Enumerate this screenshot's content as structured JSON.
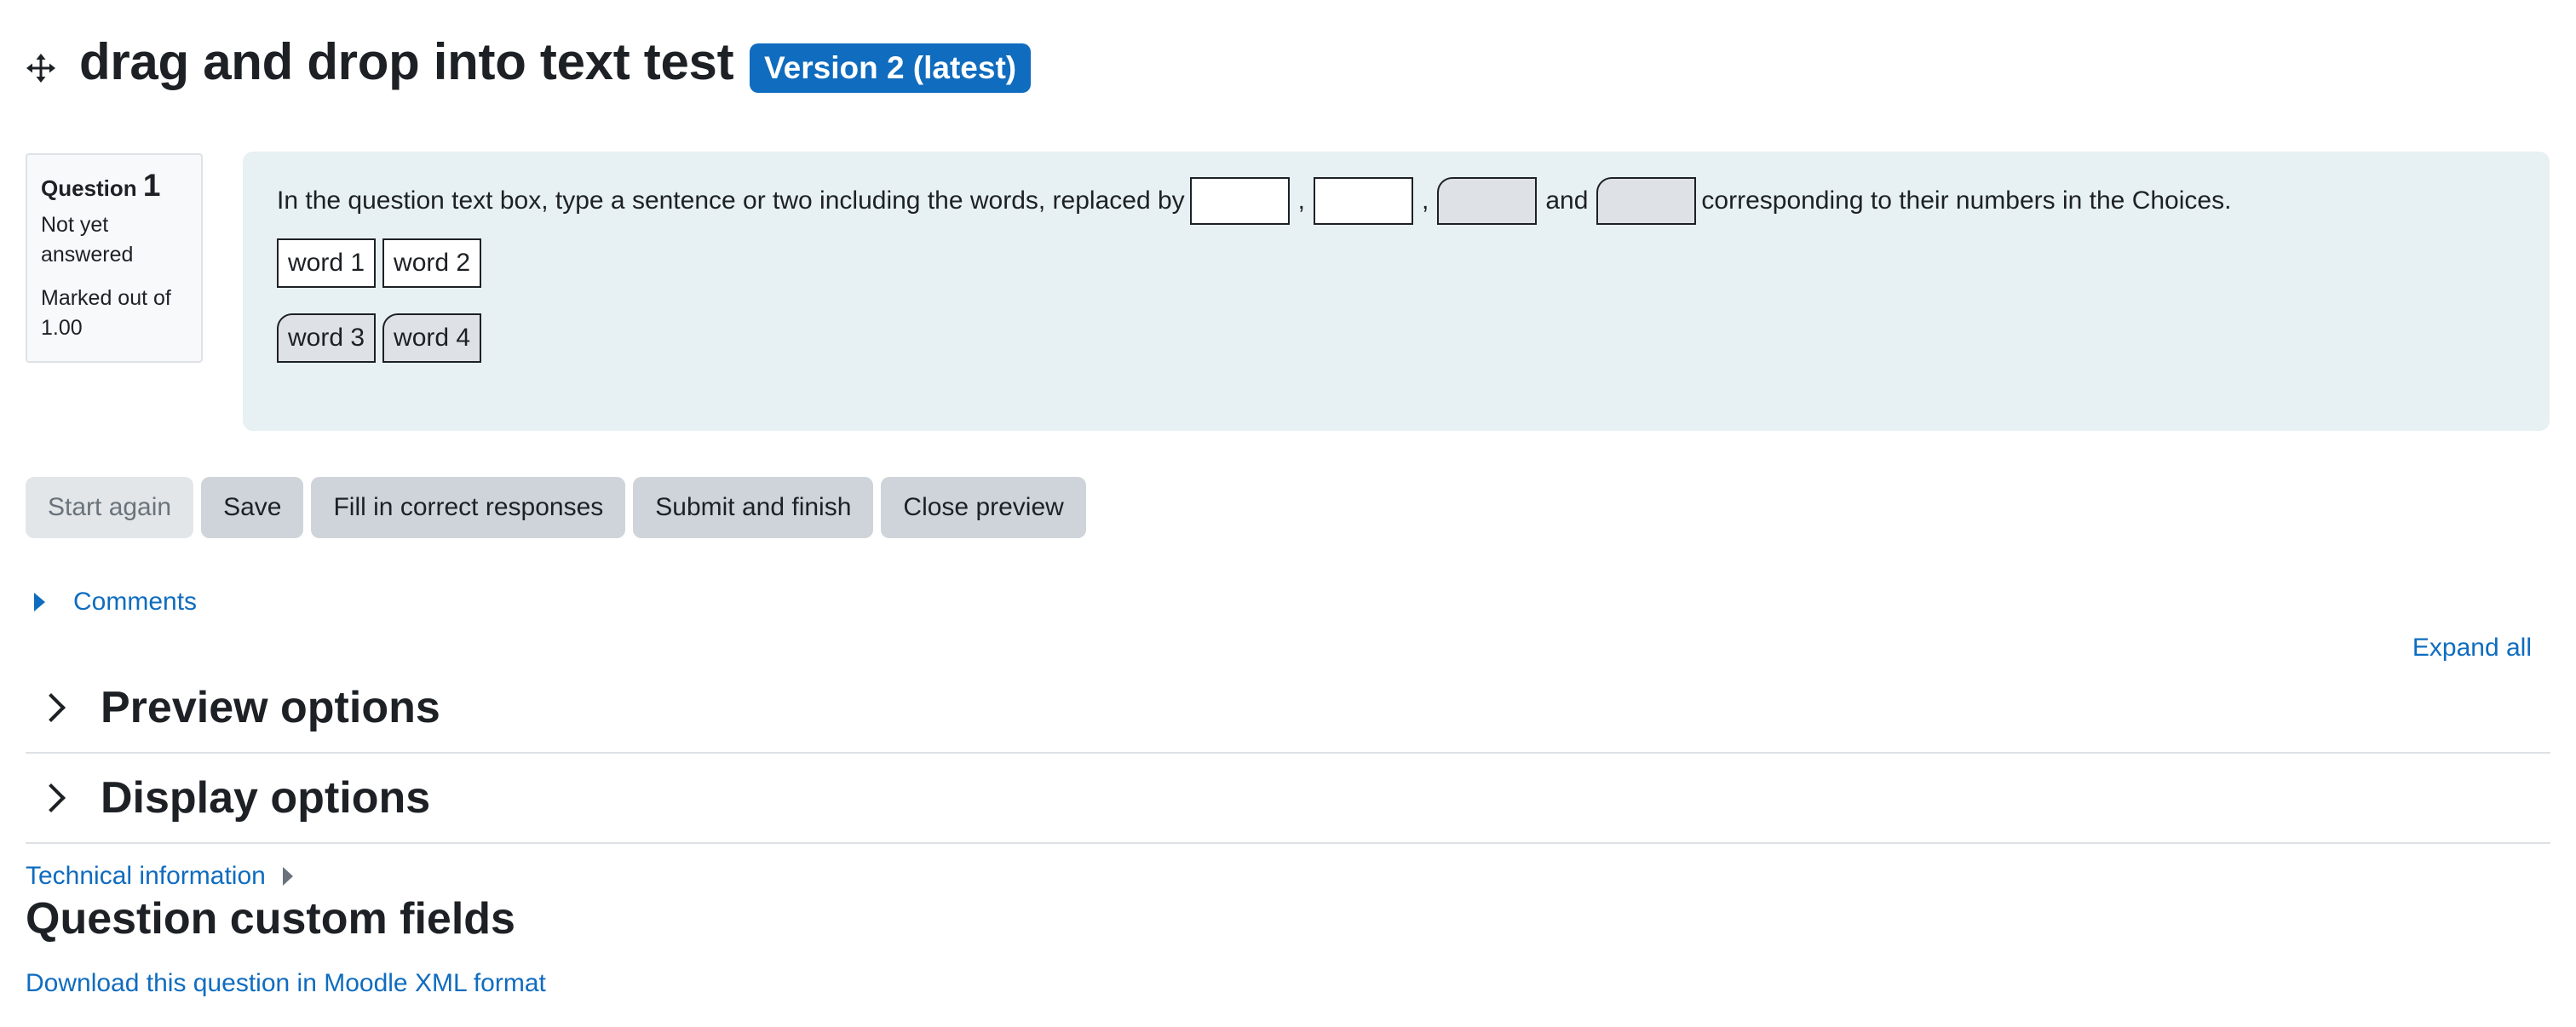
{
  "header": {
    "title": "drag and drop into text test",
    "version_badge": "Version 2 (latest)"
  },
  "question_info": {
    "label": "Question",
    "number": "1",
    "state": "Not yet answered",
    "grade": "Marked out of 1.00"
  },
  "question": {
    "text_before": "In the question text box, type a sentence or two including the words, replaced by",
    "separators": [
      ",",
      ",",
      "and"
    ],
    "text_after": "corresponding to their numbers in the Choices.",
    "choice_groups": [
      [
        "word 1",
        "word 2"
      ],
      [
        "word 3",
        "word 4"
      ]
    ]
  },
  "buttons": {
    "start_again": "Start again",
    "save": "Save",
    "fill_correct": "Fill in correct responses",
    "submit_finish": "Submit and finish",
    "close_preview": "Close preview"
  },
  "comments": {
    "label": "Comments"
  },
  "expand_all": "Expand all",
  "sections": {
    "preview_options": "Preview options",
    "display_options": "Display options"
  },
  "technical_info": "Technical information",
  "custom_fields_heading": "Question custom fields",
  "download_link": "Download this question in Moodle XML format",
  "colors": {
    "accent": "#0f6cbf",
    "question_bg": "#e7f0f3",
    "button_bg": "#ced4da",
    "group2_bg": "#dee2e6"
  },
  "icons": {
    "move": "move-icon",
    "comments_toggle": "caret-right-icon",
    "section_toggle": "chevron-right-icon",
    "technical_toggle": "caret-right-icon"
  }
}
